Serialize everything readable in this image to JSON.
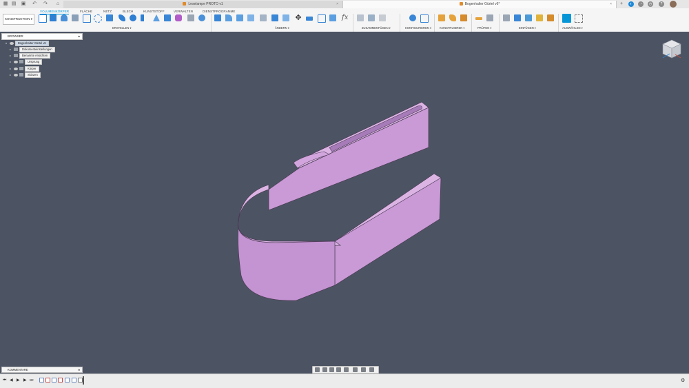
{
  "titlebar": {
    "tabs": [
      {
        "label": "Leselampe PROTO v1",
        "active": false
      },
      {
        "label": "Bogenhalter Gürtel v6*",
        "active": true
      }
    ],
    "user_initials": "",
    "new_tab_symbol": "+"
  },
  "ribbon": {
    "workspace": "KONSTRUKTION ▾",
    "tabs": [
      "VOLUMENKÖRPER",
      "FLÄCHE",
      "NETZ",
      "BLECH",
      "KUNSTSTOFF",
      "VERWALTEN",
      "DIENSTPROGRAMME"
    ],
    "groups": [
      "ERSTELLEN ▾",
      "ÄNDERN ▾",
      "ZUSAMMENFÜGEN ▾",
      "KONFIGURIEREN ▾",
      "KONSTRUIEREN ▾",
      "PRÜFEN ▾",
      "EINFÜGEN ▾",
      "AUSWÄHLEN ▾"
    ]
  },
  "browser": {
    "title": "BROWSER",
    "root": "Bogenhalter Gürtel v6",
    "items": [
      "Dokumenteinstellungen",
      "Benannte Ansichten",
      "Ursprung",
      "Körper",
      "Skizzen"
    ]
  },
  "comments": {
    "label": "KOMMENTARE"
  },
  "colors": {
    "canvas": "#4c5463",
    "part": "#c99ad6",
    "accent": "#0696d7"
  }
}
